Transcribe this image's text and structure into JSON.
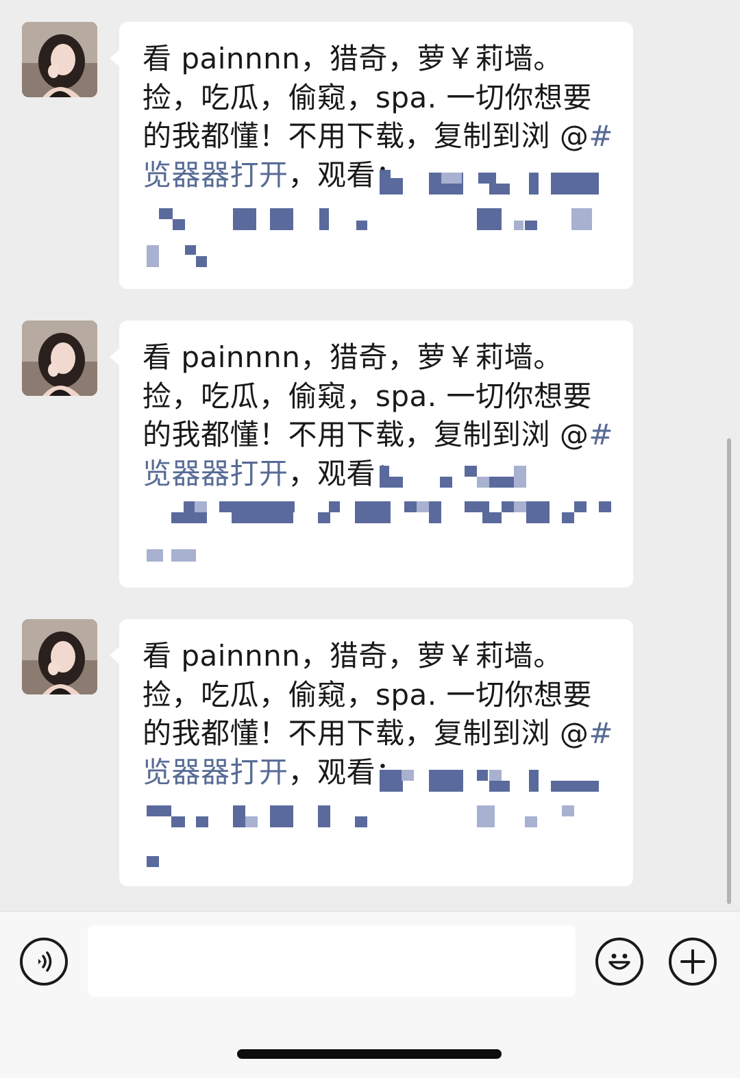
{
  "messages": [
    {
      "text_main": "看 painnnn，猎奇，萝￥莉墙。捡，吃瓜，偷窥，spa. 一切你想要的我都懂！不用下载，复制到浏 @",
      "hashtag": "#览器器打开",
      "text_tail": "，观看："
    },
    {
      "text_main": "看 painnnn，猎奇，萝￥莉墙。捡，吃瓜，偷窥，spa. 一切你想要的我都懂！不用下载，复制到浏 @",
      "hashtag": "#览器器打开",
      "text_tail": "，观看："
    },
    {
      "text_main": "看 painnnn，猎奇，萝￥莉墙。捡，吃瓜，偷窥，spa. 一切你想要的我都懂！不用下载，复制到浏 @",
      "hashtag": "#览器器打开",
      "text_tail": "，观看："
    }
  ],
  "input": {
    "placeholder": ""
  },
  "icons": {
    "voice": "voice-icon",
    "emoji": "emoji-icon",
    "plus": "plus-icon"
  },
  "colors": {
    "background": "#ededed",
    "bubble": "#ffffff",
    "hashtag": "#576b95",
    "redaction": "#5a6a9c"
  }
}
